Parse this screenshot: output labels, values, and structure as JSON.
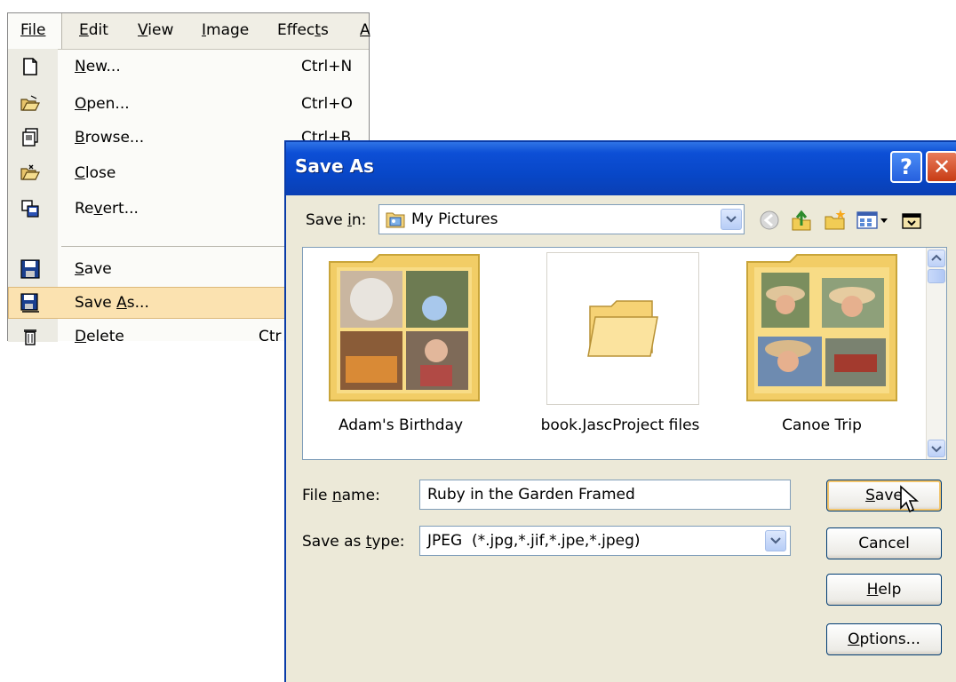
{
  "menu": {
    "menubar": [
      {
        "label": "File",
        "accel": "F"
      },
      {
        "label": "Edit",
        "accel": "E"
      },
      {
        "label": "View",
        "accel": "V"
      },
      {
        "label": "Image",
        "accel": "I"
      },
      {
        "label": "Effects",
        "accel": "t"
      },
      {
        "label": "A",
        "accel": "A"
      }
    ],
    "items": [
      {
        "label_pre": "",
        "label_u": "N",
        "label_post": "ew...",
        "shortcut": "Ctrl+N",
        "icon": "new-file-icon"
      },
      {
        "label_pre": "",
        "label_u": "O",
        "label_post": "pen...",
        "shortcut": "Ctrl+O",
        "icon": "open-folder-icon"
      },
      {
        "label_pre": "",
        "label_u": "B",
        "label_post": "rowse...",
        "shortcut": "Ctrl+B",
        "icon": "browse-icon"
      },
      {
        "label_pre": "",
        "label_u": "C",
        "label_post": "lose",
        "shortcut": "",
        "icon": "close-folder-icon"
      },
      {
        "label_pre": "Re",
        "label_u": "v",
        "label_post": "ert...",
        "shortcut": "",
        "icon": "revert-icon"
      },
      {
        "label_pre": "",
        "label_u": "S",
        "label_post": "ave",
        "shortcut": "",
        "icon": "save-disk-icon"
      },
      {
        "label_pre": "Save ",
        "label_u": "A",
        "label_post": "s...",
        "shortcut": "",
        "icon": "save-as-icon",
        "highlighted": true
      },
      {
        "label_pre": "",
        "label_u": "D",
        "label_post": "elete",
        "shortcut": "Ctr",
        "icon": "trash-icon"
      }
    ]
  },
  "dialog": {
    "title": "Save As",
    "title_help": "?",
    "title_close": "✕",
    "save_in": {
      "label_pre": "Save ",
      "label_u": "i",
      "label_post": "n:",
      "value": "My Pictures"
    },
    "files": [
      {
        "name": "Adam's Birthday"
      },
      {
        "name": "book.JascProject files"
      },
      {
        "name": "Canoe Trip"
      }
    ],
    "file_name": {
      "label_pre": "File ",
      "label_u": "n",
      "label_post": "ame:",
      "value": "Ruby in the Garden Framed"
    },
    "save_type": {
      "label_pre": "Save as ",
      "label_u": "t",
      "label_post": "ype:",
      "value": "JPEG  (*.jpg,*.jif,*.jpe,*.jpeg)"
    },
    "buttons": {
      "save": {
        "label_pre": "",
        "label_u": "S",
        "label_post": "ave"
      },
      "cancel": {
        "label": "Cancel"
      },
      "help": {
        "label_pre": "",
        "label_u": "H",
        "label_post": "elp"
      },
      "options": {
        "label_pre": "",
        "label_u": "O",
        "label_post": "ptions..."
      }
    }
  },
  "colors": {
    "titlebar": "#0847c8",
    "menu_highlight": "#fbe2b0",
    "dialog_bg": "#ece9d8"
  }
}
